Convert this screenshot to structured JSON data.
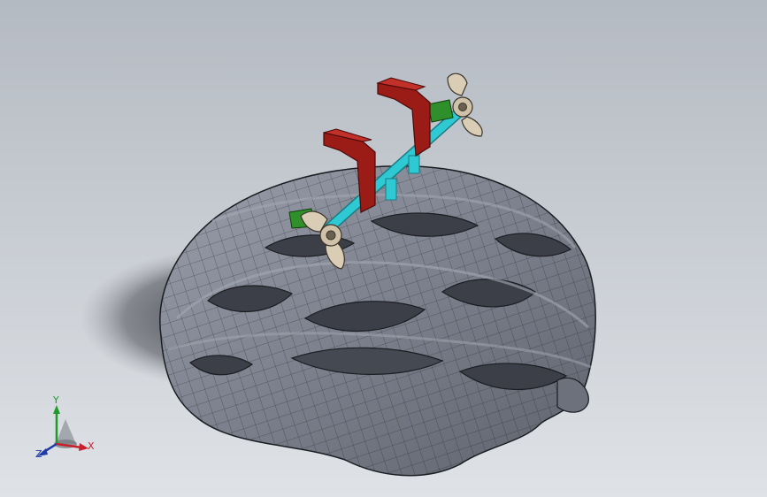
{
  "viewport": {
    "background_top": "#b4bac2",
    "background_bottom": "#dfe2e6"
  },
  "model": {
    "helmet_color": "#7b808c",
    "helmet_edge_color": "#1b1d22",
    "clamp_color": "#9b1b16",
    "rod_color": "#2fc9d3",
    "pad_color": "#2f8f2a",
    "wingnut_color": "#d9cdb6"
  },
  "triad": {
    "x_label": "X",
    "y_label": "Y",
    "z_label": "Z",
    "x_color": "#c8202a",
    "y_color": "#1f9a2a",
    "z_color": "#1d3aa8"
  }
}
